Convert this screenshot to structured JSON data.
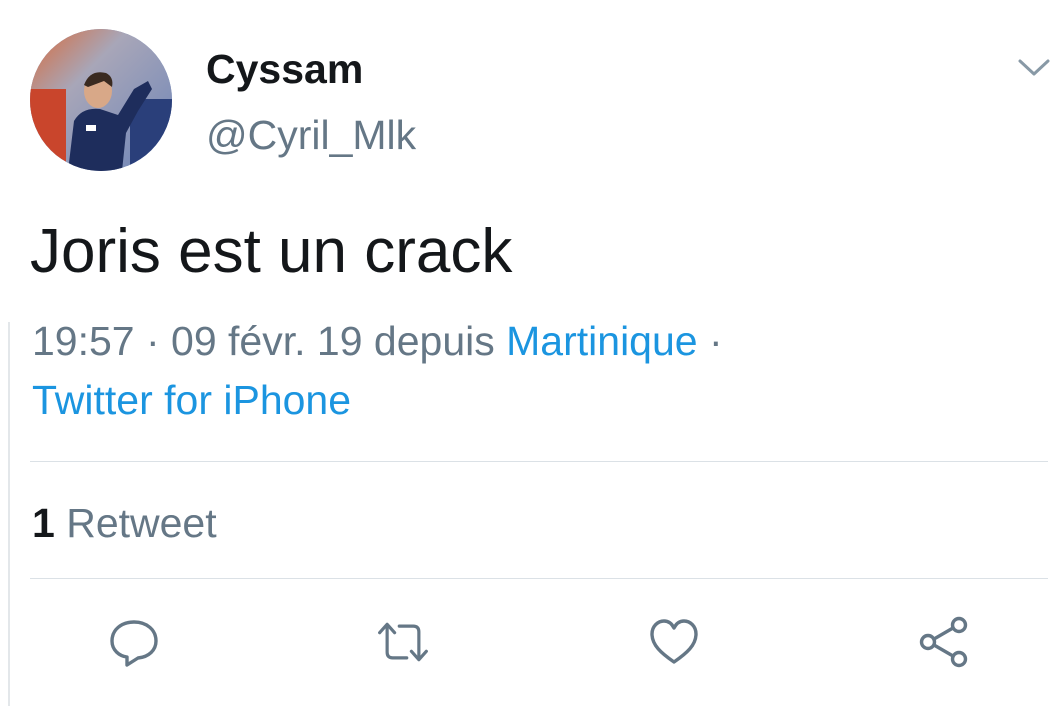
{
  "author": {
    "display_name": "Cyssam",
    "handle": "@Cyril_Mlk",
    "avatar_icon": "avatar-photo"
  },
  "tweet": {
    "text": "Joris est un crack",
    "time": "19:57",
    "date": "09 févr. 19",
    "location_prefix": "depuis",
    "location": "Martinique",
    "source": "Twitter for iPhone"
  },
  "stats": {
    "retweet_count": "1",
    "retweet_label": "Retweet"
  },
  "actions": {
    "reply_icon": "reply-icon",
    "retweet_icon": "retweet-icon",
    "like_icon": "heart-icon",
    "share_icon": "share-icon"
  },
  "colors": {
    "text_primary": "#14171a",
    "text_secondary": "#657786",
    "link": "#1b95e0",
    "divider": "#dbe1e6"
  }
}
